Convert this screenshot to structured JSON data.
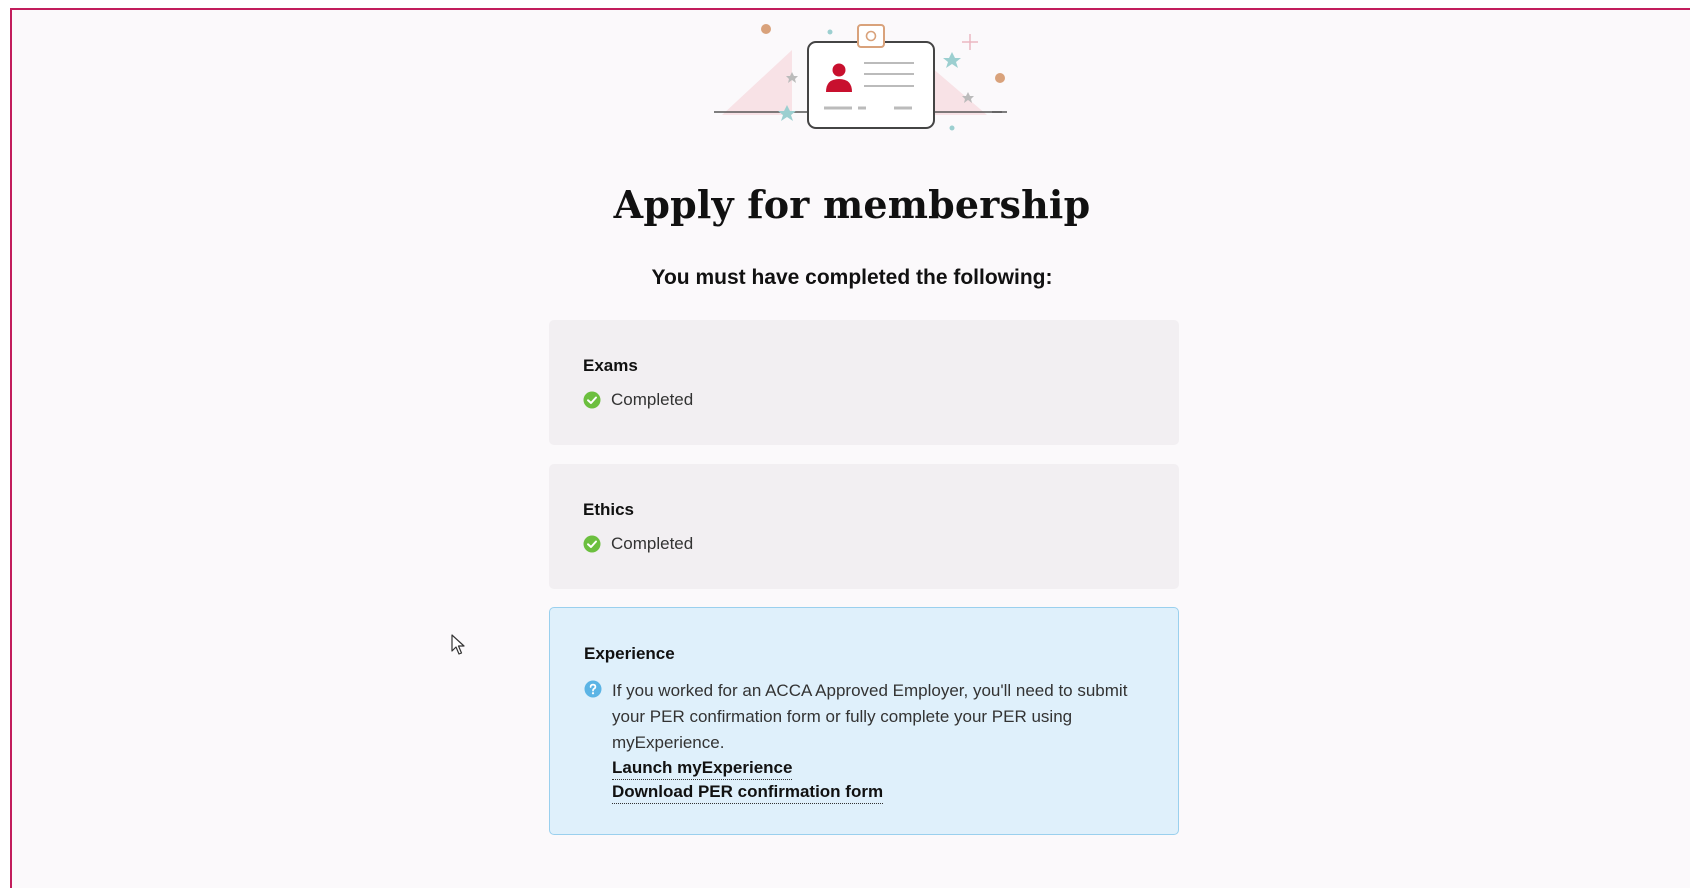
{
  "page": {
    "title": "Apply for membership",
    "subtitle": "You must have completed the following:"
  },
  "requirements": [
    {
      "title": "Exams",
      "status": "Completed",
      "icon": "check-circle-icon",
      "color": "#6cbf3f"
    },
    {
      "title": "Ethics",
      "status": "Completed",
      "icon": "check-circle-icon",
      "color": "#6cbf3f"
    }
  ],
  "experience": {
    "title": "Experience",
    "icon": "info-icon",
    "info_text": "If you worked for an ACCA Approved Employer, you'll need to submit your PER confirmation form or fully complete your PER using myExperience.",
    "links": [
      "Launch myExperience",
      "Download PER confirmation form"
    ],
    "color": "#5bb4e5"
  },
  "theme": {
    "frame_border": "#c21d5c",
    "background": "#fbf9fb",
    "card_grey": "#f2eff2",
    "card_blue": "#dff0fb",
    "accent_red": "#c8102e"
  }
}
